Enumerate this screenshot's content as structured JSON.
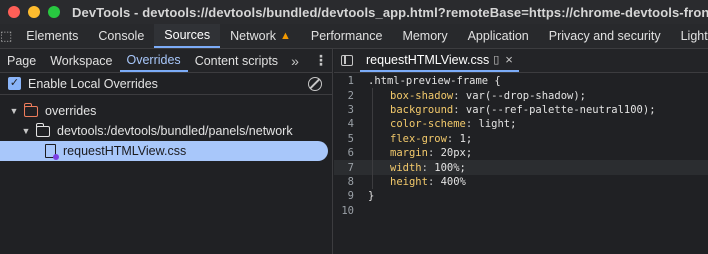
{
  "window": {
    "title": "DevTools - devtools://devtools/bundled/devtools_app.html?remoteBase=https://chrome-devtools-frontend.apps",
    "traffic_lights": {
      "close": "#ff5f57",
      "minimize": "#febc2e",
      "zoom": "#28c840"
    }
  },
  "main_tabs": [
    {
      "label": "Elements"
    },
    {
      "label": "Console"
    },
    {
      "label": "Sources",
      "active": true
    },
    {
      "label": "Network",
      "warning_icon": "warning-triangle-icon"
    },
    {
      "label": "Performance"
    },
    {
      "label": "Memory"
    },
    {
      "label": "Application"
    },
    {
      "label": "Privacy and security"
    },
    {
      "label": "Lighthouse"
    }
  ],
  "navigator": {
    "tabs": [
      {
        "label": "Page"
      },
      {
        "label": "Workspace"
      },
      {
        "label": "Overrides",
        "active": true
      },
      {
        "label": "Content scripts"
      }
    ],
    "more_label": "»",
    "menu_label": "⋮",
    "enable_overrides": {
      "label": "Enable Local Overrides",
      "checked": true
    },
    "tree": [
      {
        "label": "overrides",
        "depth": 0,
        "expanded": true,
        "icon": "folder-icon"
      },
      {
        "label": "devtools:/devtools/bundled/panels/network",
        "depth": 1,
        "expanded": true,
        "icon": "folder-icon"
      },
      {
        "label": "requestHTMLView.css",
        "depth": 2,
        "selected": true,
        "icon": "file-icon"
      }
    ]
  },
  "editor": {
    "tab_label": "requestHTMLView.css",
    "close_label": "×",
    "current_line": 7,
    "lines": [
      {
        "n": "1",
        "sel": ".html-preview-frame {"
      },
      {
        "n": "2",
        "prop": "box-shadow",
        "val": "var(--drop-shadow);"
      },
      {
        "n": "3",
        "prop": "background",
        "val": "var(--ref-palette-neutral100);"
      },
      {
        "n": "4",
        "prop": "color-scheme",
        "val": "light;"
      },
      {
        "n": "5",
        "prop": "flex-grow",
        "val": "1;"
      },
      {
        "n": "6",
        "prop": "margin",
        "val": "20px;"
      },
      {
        "n": "7",
        "prop": "width",
        "val": "100%;"
      },
      {
        "n": "8",
        "prop": "height",
        "val": "400%"
      },
      {
        "n": "9",
        "sel": "}"
      },
      {
        "n": "10",
        "sel": ""
      }
    ]
  }
}
